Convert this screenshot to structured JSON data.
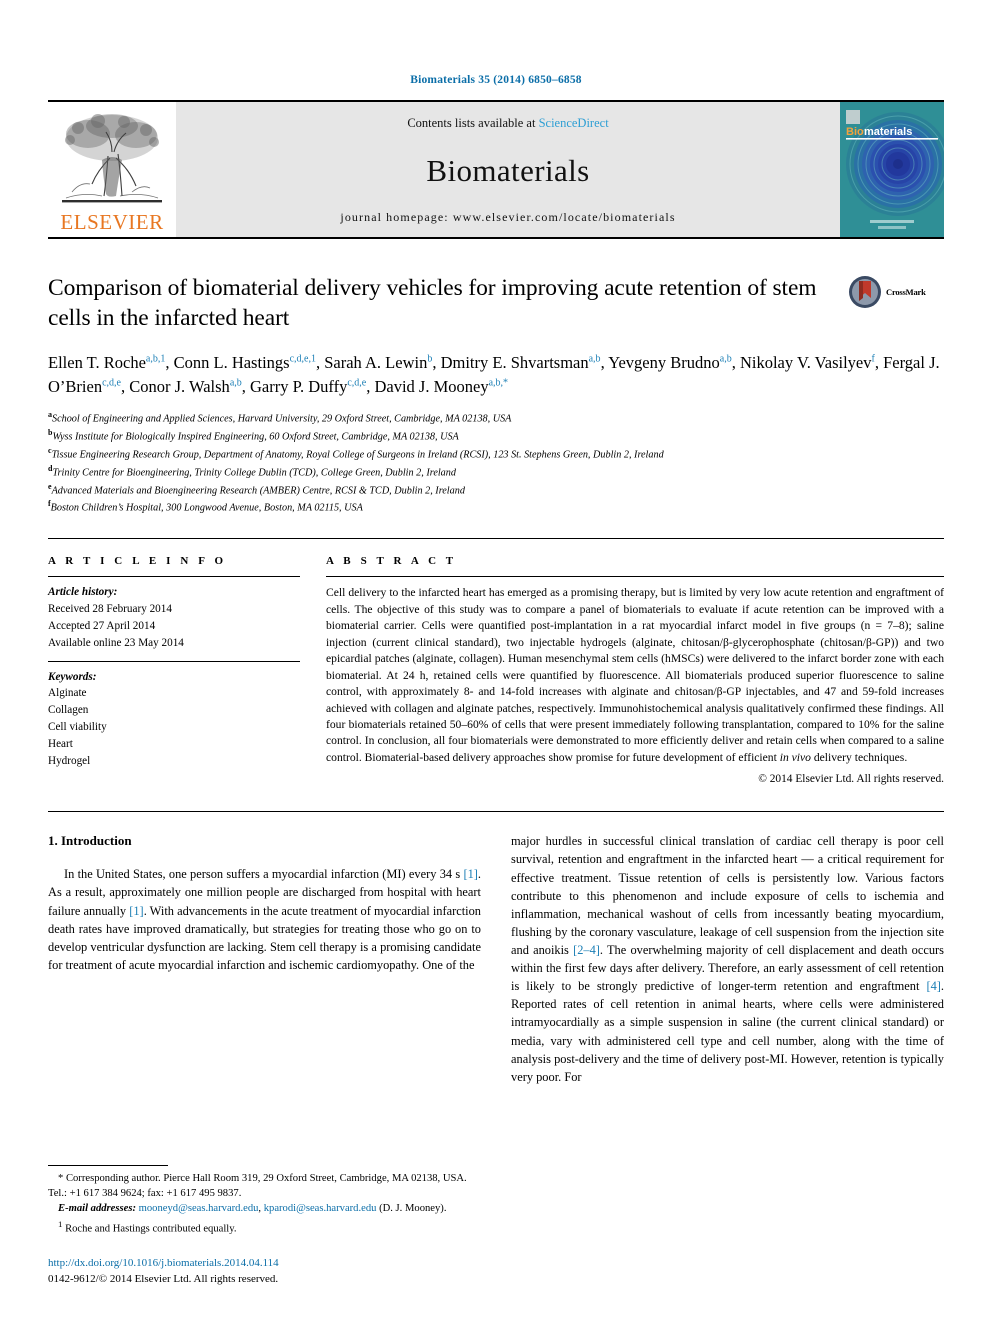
{
  "running_head": "Biomaterials 35 (2014) 6850–6858",
  "masthead": {
    "publisher": "ELSEVIER",
    "contents_line_prefix": "Contents lists available at ",
    "sciencedirect": "ScienceDirect",
    "journal_title": "Biomaterials",
    "homepage": "journal homepage: www.elsevier.com/locate/biomaterials",
    "cover_title_a": "Bio",
    "cover_title_b": "materials"
  },
  "article": {
    "title": "Comparison of biomaterial delivery vehicles for improving acute retention of stem cells in the infarcted heart",
    "crossmark_label": "CrossMark",
    "authors": [
      {
        "name": "Ellen T. Roche",
        "sup": "a,b,1",
        "sep": ", "
      },
      {
        "name": "Conn L. Hastings",
        "sup": "c,d,e,1",
        "sep": ", "
      },
      {
        "name": "Sarah A. Lewin",
        "sup": "b",
        "sep": ", "
      },
      {
        "name": "Dmitry E. Shvartsman",
        "sup": "a,b",
        "sep": ", "
      },
      {
        "name": "Yevgeny Brudno",
        "sup": "a,b",
        "sep": ", "
      },
      {
        "name": "Nikolay V. Vasilyev",
        "sup": "f",
        "sep": ", "
      },
      {
        "name": "Fergal J. O’Brien",
        "sup": "c,d,e",
        "sep": ", "
      },
      {
        "name": "Conor J. Walsh",
        "sup": "a,b",
        "sep": ", "
      },
      {
        "name": "Garry P. Duffy",
        "sup": "c,d,e",
        "sep": ", "
      },
      {
        "name": "David J. Mooney",
        "sup": "a,b,*",
        "sep": ""
      }
    ],
    "affiliations": [
      {
        "mark": "a",
        "text": "School of Engineering and Applied Sciences, Harvard University, 29 Oxford Street, Cambridge, MA 02138, USA"
      },
      {
        "mark": "b",
        "text": "Wyss Institute for Biologically Inspired Engineering, 60 Oxford Street, Cambridge, MA 02138, USA"
      },
      {
        "mark": "c",
        "text": "Tissue Engineering Research Group, Department of Anatomy, Royal College of Surgeons in Ireland (RCSI), 123 St. Stephens Green, Dublin 2, Ireland"
      },
      {
        "mark": "d",
        "text": "Trinity Centre for Bioengineering, Trinity College Dublin (TCD), College Green, Dublin 2, Ireland"
      },
      {
        "mark": "e",
        "text": "Advanced Materials and Bioengineering Research (AMBER) Centre, RCSI & TCD, Dublin 2, Ireland"
      },
      {
        "mark": "f",
        "text": "Boston Children’s Hospital, 300 Longwood Avenue, Boston, MA 02115, USA"
      }
    ]
  },
  "article_info": {
    "heading": "A R T I C L E   I N F O",
    "history_label": "Article history:",
    "history": [
      "Received 28 February 2014",
      "Accepted 27 April 2014",
      "Available online 23 May 2014"
    ],
    "keywords_label": "Keywords:",
    "keywords": [
      "Alginate",
      "Collagen",
      "Cell viability",
      "Heart",
      "Hydrogel"
    ]
  },
  "abstract": {
    "heading": "A B S T R A C T",
    "text": "Cell delivery to the infarcted heart has emerged as a promising therapy, but is limited by very low acute retention and engraftment of cells. The objective of this study was to compare a panel of biomaterials to evaluate if acute retention can be improved with a biomaterial carrier. Cells were quantified post-implantation in a rat myocardial infarct model in five groups (n = 7–8); saline injection (current clinical standard), two injectable hydrogels (alginate, chitosan/β-glycerophosphate (chitosan/β-GP)) and two epicardial patches (alginate, collagen). Human mesenchymal stem cells (hMSCs) were delivered to the infarct border zone with each biomaterial. At 24 h, retained cells were quantified by fluorescence. All biomaterials produced superior fluorescence to saline control, with approximately 8- and 14-fold increases with alginate and chitosan/β-GP injectables, and 47 and 59-fold increases achieved with collagen and alginate patches, respectively. Immunohistochemical analysis qualitatively confirmed these findings. All four biomaterials retained 50–60% of cells that were present immediately following transplantation, compared to 10% for the saline control. In conclusion, all four biomaterials were demonstrated to more efficiently deliver and retain cells when compared to a saline control. Biomaterial-based delivery approaches show promise for future development of efficient ",
    "text_italic": "in vivo",
    "text_end": " delivery techniques.",
    "copyright": "© 2014 Elsevier Ltd. All rights reserved."
  },
  "introduction": {
    "heading": "1. Introduction",
    "left_p1_a": "In the United States, one person suffers a myocardial infarction (MI) every 34 s ",
    "left_cite_1": "[1]",
    "left_p1_b": ". As a result, approximately one million people are discharged from hospital with heart failure annually ",
    "left_cite_2": "[1]",
    "left_p1_c": ". With advancements in the acute treatment of myocardial infarction death rates have improved dramatically, but strategies for treating those who go on to develop ventricular dysfunction are lacking. Stem cell therapy is a promising candidate for treatment of acute myocardial infarction and ischemic cardiomyopathy. One of the",
    "right_a": "major hurdles in successful clinical translation of cardiac cell therapy is poor cell survival, retention and engraftment in the infarcted heart — a critical requirement for effective treatment. Tissue retention of cells is persistently low. Various factors contribute to this phenomenon and include exposure of cells to ischemia and inflammation, mechanical washout of cells from incessantly beating myocardium, flushing by the coronary vasculature, leakage of cell suspension from the injection site and anoikis ",
    "right_cite_1": "[2–4]",
    "right_b": ". The overwhelming majority of cell displacement and death occurs within the first few days after delivery. Therefore, an early assessment of cell retention is likely to be strongly predictive of longer-term retention and engraftment ",
    "right_cite_2": "[4]",
    "right_c": ". Reported rates of cell retention in animal hearts, where cells were administered intramyocardially as a simple suspension in saline (the current clinical standard) or media, vary with administered cell type and cell number, along with the time of analysis post-delivery and the time of delivery post-MI. However, retention is typically very poor. For"
  },
  "footnotes": {
    "corresponding": "* Corresponding author. Pierce Hall Room 319, 29 Oxford Street, Cambridge, MA 02138, USA. Tel.: +1 617 384 9624; fax: +1 617 495 9837.",
    "email_label": "E-mail addresses:",
    "email_1": "mooneyd@seas.harvard.edu",
    "email_sep": ", ",
    "email_2": "kparodi@seas.harvard.edu",
    "email_tail": " (D. J. Mooney).",
    "equal_contrib_mark": "1",
    "equal_contrib": " Roche and Hastings contributed equally.",
    "doi": "http://dx.doi.org/10.1016/j.biomaterials.2014.04.114",
    "issn_line": "0142-9612/© 2014 Elsevier Ltd. All rights reserved."
  },
  "colors": {
    "link_blue": "#0b6ea8",
    "cite_blue": "#1a7eb5",
    "sciencedirect_blue": "#2e9fd4",
    "elsevier_orange": "#E87722",
    "banner_gray": "#e6e6e6",
    "cover_teal": "#2a8c94"
  }
}
